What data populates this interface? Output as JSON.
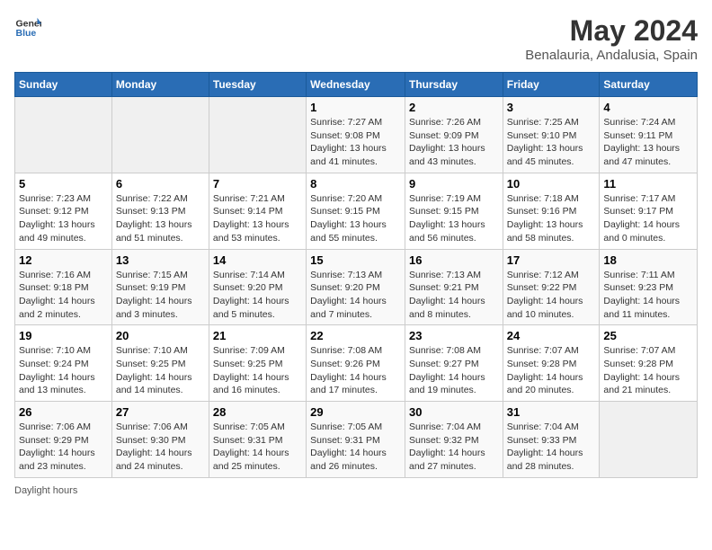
{
  "header": {
    "logo_general": "General",
    "logo_blue": "Blue",
    "title": "May 2024",
    "subtitle": "Benalauria, Andalusia, Spain"
  },
  "calendar": {
    "days_of_week": [
      "Sunday",
      "Monday",
      "Tuesday",
      "Wednesday",
      "Thursday",
      "Friday",
      "Saturday"
    ],
    "weeks": [
      [
        {
          "day": "",
          "sunrise": "",
          "sunset": "",
          "daylight": "",
          "empty": true
        },
        {
          "day": "",
          "sunrise": "",
          "sunset": "",
          "daylight": "",
          "empty": true
        },
        {
          "day": "",
          "sunrise": "",
          "sunset": "",
          "daylight": "",
          "empty": true
        },
        {
          "day": "1",
          "sunrise": "Sunrise: 7:27 AM",
          "sunset": "Sunset: 9:08 PM",
          "daylight": "Daylight: 13 hours and 41 minutes.",
          "empty": false
        },
        {
          "day": "2",
          "sunrise": "Sunrise: 7:26 AM",
          "sunset": "Sunset: 9:09 PM",
          "daylight": "Daylight: 13 hours and 43 minutes.",
          "empty": false
        },
        {
          "day": "3",
          "sunrise": "Sunrise: 7:25 AM",
          "sunset": "Sunset: 9:10 PM",
          "daylight": "Daylight: 13 hours and 45 minutes.",
          "empty": false
        },
        {
          "day": "4",
          "sunrise": "Sunrise: 7:24 AM",
          "sunset": "Sunset: 9:11 PM",
          "daylight": "Daylight: 13 hours and 47 minutes.",
          "empty": false
        }
      ],
      [
        {
          "day": "5",
          "sunrise": "Sunrise: 7:23 AM",
          "sunset": "Sunset: 9:12 PM",
          "daylight": "Daylight: 13 hours and 49 minutes.",
          "empty": false
        },
        {
          "day": "6",
          "sunrise": "Sunrise: 7:22 AM",
          "sunset": "Sunset: 9:13 PM",
          "daylight": "Daylight: 13 hours and 51 minutes.",
          "empty": false
        },
        {
          "day": "7",
          "sunrise": "Sunrise: 7:21 AM",
          "sunset": "Sunset: 9:14 PM",
          "daylight": "Daylight: 13 hours and 53 minutes.",
          "empty": false
        },
        {
          "day": "8",
          "sunrise": "Sunrise: 7:20 AM",
          "sunset": "Sunset: 9:15 PM",
          "daylight": "Daylight: 13 hours and 55 minutes.",
          "empty": false
        },
        {
          "day": "9",
          "sunrise": "Sunrise: 7:19 AM",
          "sunset": "Sunset: 9:15 PM",
          "daylight": "Daylight: 13 hours and 56 minutes.",
          "empty": false
        },
        {
          "day": "10",
          "sunrise": "Sunrise: 7:18 AM",
          "sunset": "Sunset: 9:16 PM",
          "daylight": "Daylight: 13 hours and 58 minutes.",
          "empty": false
        },
        {
          "day": "11",
          "sunrise": "Sunrise: 7:17 AM",
          "sunset": "Sunset: 9:17 PM",
          "daylight": "Daylight: 14 hours and 0 minutes.",
          "empty": false
        }
      ],
      [
        {
          "day": "12",
          "sunrise": "Sunrise: 7:16 AM",
          "sunset": "Sunset: 9:18 PM",
          "daylight": "Daylight: 14 hours and 2 minutes.",
          "empty": false
        },
        {
          "day": "13",
          "sunrise": "Sunrise: 7:15 AM",
          "sunset": "Sunset: 9:19 PM",
          "daylight": "Daylight: 14 hours and 3 minutes.",
          "empty": false
        },
        {
          "day": "14",
          "sunrise": "Sunrise: 7:14 AM",
          "sunset": "Sunset: 9:20 PM",
          "daylight": "Daylight: 14 hours and 5 minutes.",
          "empty": false
        },
        {
          "day": "15",
          "sunrise": "Sunrise: 7:13 AM",
          "sunset": "Sunset: 9:20 PM",
          "daylight": "Daylight: 14 hours and 7 minutes.",
          "empty": false
        },
        {
          "day": "16",
          "sunrise": "Sunrise: 7:13 AM",
          "sunset": "Sunset: 9:21 PM",
          "daylight": "Daylight: 14 hours and 8 minutes.",
          "empty": false
        },
        {
          "day": "17",
          "sunrise": "Sunrise: 7:12 AM",
          "sunset": "Sunset: 9:22 PM",
          "daylight": "Daylight: 14 hours and 10 minutes.",
          "empty": false
        },
        {
          "day": "18",
          "sunrise": "Sunrise: 7:11 AM",
          "sunset": "Sunset: 9:23 PM",
          "daylight": "Daylight: 14 hours and 11 minutes.",
          "empty": false
        }
      ],
      [
        {
          "day": "19",
          "sunrise": "Sunrise: 7:10 AM",
          "sunset": "Sunset: 9:24 PM",
          "daylight": "Daylight: 14 hours and 13 minutes.",
          "empty": false
        },
        {
          "day": "20",
          "sunrise": "Sunrise: 7:10 AM",
          "sunset": "Sunset: 9:25 PM",
          "daylight": "Daylight: 14 hours and 14 minutes.",
          "empty": false
        },
        {
          "day": "21",
          "sunrise": "Sunrise: 7:09 AM",
          "sunset": "Sunset: 9:25 PM",
          "daylight": "Daylight: 14 hours and 16 minutes.",
          "empty": false
        },
        {
          "day": "22",
          "sunrise": "Sunrise: 7:08 AM",
          "sunset": "Sunset: 9:26 PM",
          "daylight": "Daylight: 14 hours and 17 minutes.",
          "empty": false
        },
        {
          "day": "23",
          "sunrise": "Sunrise: 7:08 AM",
          "sunset": "Sunset: 9:27 PM",
          "daylight": "Daylight: 14 hours and 19 minutes.",
          "empty": false
        },
        {
          "day": "24",
          "sunrise": "Sunrise: 7:07 AM",
          "sunset": "Sunset: 9:28 PM",
          "daylight": "Daylight: 14 hours and 20 minutes.",
          "empty": false
        },
        {
          "day": "25",
          "sunrise": "Sunrise: 7:07 AM",
          "sunset": "Sunset: 9:28 PM",
          "daylight": "Daylight: 14 hours and 21 minutes.",
          "empty": false
        }
      ],
      [
        {
          "day": "26",
          "sunrise": "Sunrise: 7:06 AM",
          "sunset": "Sunset: 9:29 PM",
          "daylight": "Daylight: 14 hours and 23 minutes.",
          "empty": false
        },
        {
          "day": "27",
          "sunrise": "Sunrise: 7:06 AM",
          "sunset": "Sunset: 9:30 PM",
          "daylight": "Daylight: 14 hours and 24 minutes.",
          "empty": false
        },
        {
          "day": "28",
          "sunrise": "Sunrise: 7:05 AM",
          "sunset": "Sunset: 9:31 PM",
          "daylight": "Daylight: 14 hours and 25 minutes.",
          "empty": false
        },
        {
          "day": "29",
          "sunrise": "Sunrise: 7:05 AM",
          "sunset": "Sunset: 9:31 PM",
          "daylight": "Daylight: 14 hours and 26 minutes.",
          "empty": false
        },
        {
          "day": "30",
          "sunrise": "Sunrise: 7:04 AM",
          "sunset": "Sunset: 9:32 PM",
          "daylight": "Daylight: 14 hours and 27 minutes.",
          "empty": false
        },
        {
          "day": "31",
          "sunrise": "Sunrise: 7:04 AM",
          "sunset": "Sunset: 9:33 PM",
          "daylight": "Daylight: 14 hours and 28 minutes.",
          "empty": false
        },
        {
          "day": "",
          "sunrise": "",
          "sunset": "",
          "daylight": "",
          "empty": true
        }
      ]
    ]
  },
  "footer": {
    "daylight_label": "Daylight hours"
  }
}
